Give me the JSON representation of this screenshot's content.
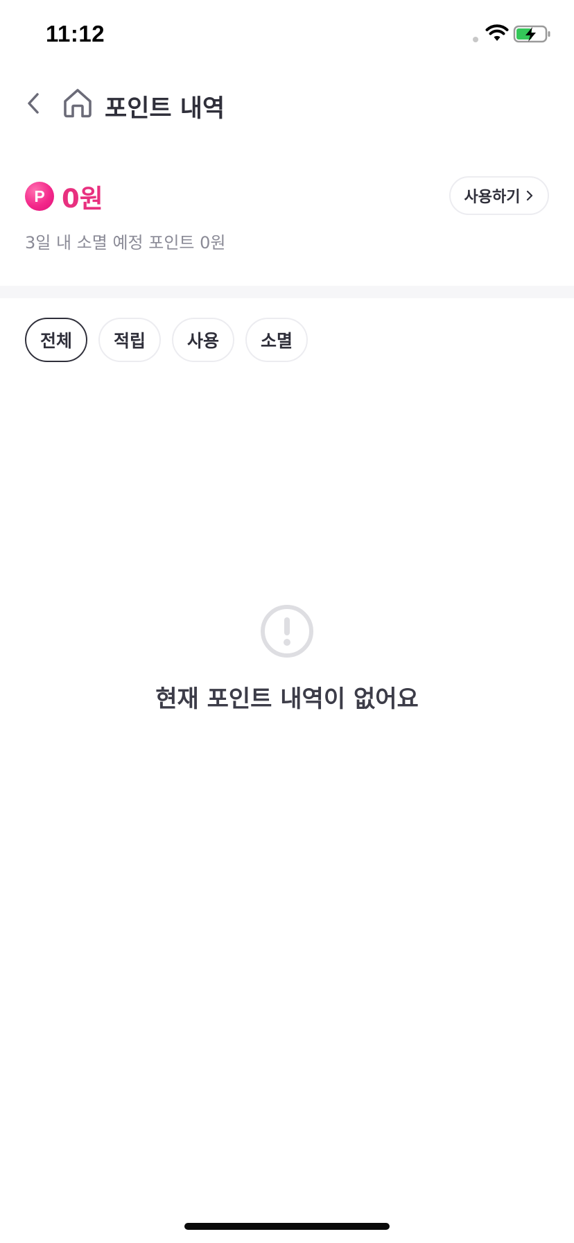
{
  "status_bar": {
    "time": "11:12",
    "wifi_icon": "wifi-icon",
    "battery_icon": "battery-charging-icon"
  },
  "header": {
    "back_icon": "chevron-left-icon",
    "home_icon": "home-icon",
    "title": "포인트 내역"
  },
  "points": {
    "badge_letter": "P",
    "badge_color": "#f3288a",
    "balance": "0원",
    "balance_color": "#e8307f",
    "use_button_label": "사용하기",
    "use_button_icon": "chevron-right-icon",
    "expiring_text": "3일 내 소멸 예정 포인트 0원"
  },
  "filters": {
    "selected": "전체",
    "chips": [
      {
        "label": "전체",
        "active": true
      },
      {
        "label": "적립",
        "active": false
      },
      {
        "label": "사용",
        "active": false
      },
      {
        "label": "소멸",
        "active": false
      }
    ]
  },
  "empty_state": {
    "icon": "alert-circle-icon",
    "message": "현재 포인트 내역이 없어요"
  }
}
